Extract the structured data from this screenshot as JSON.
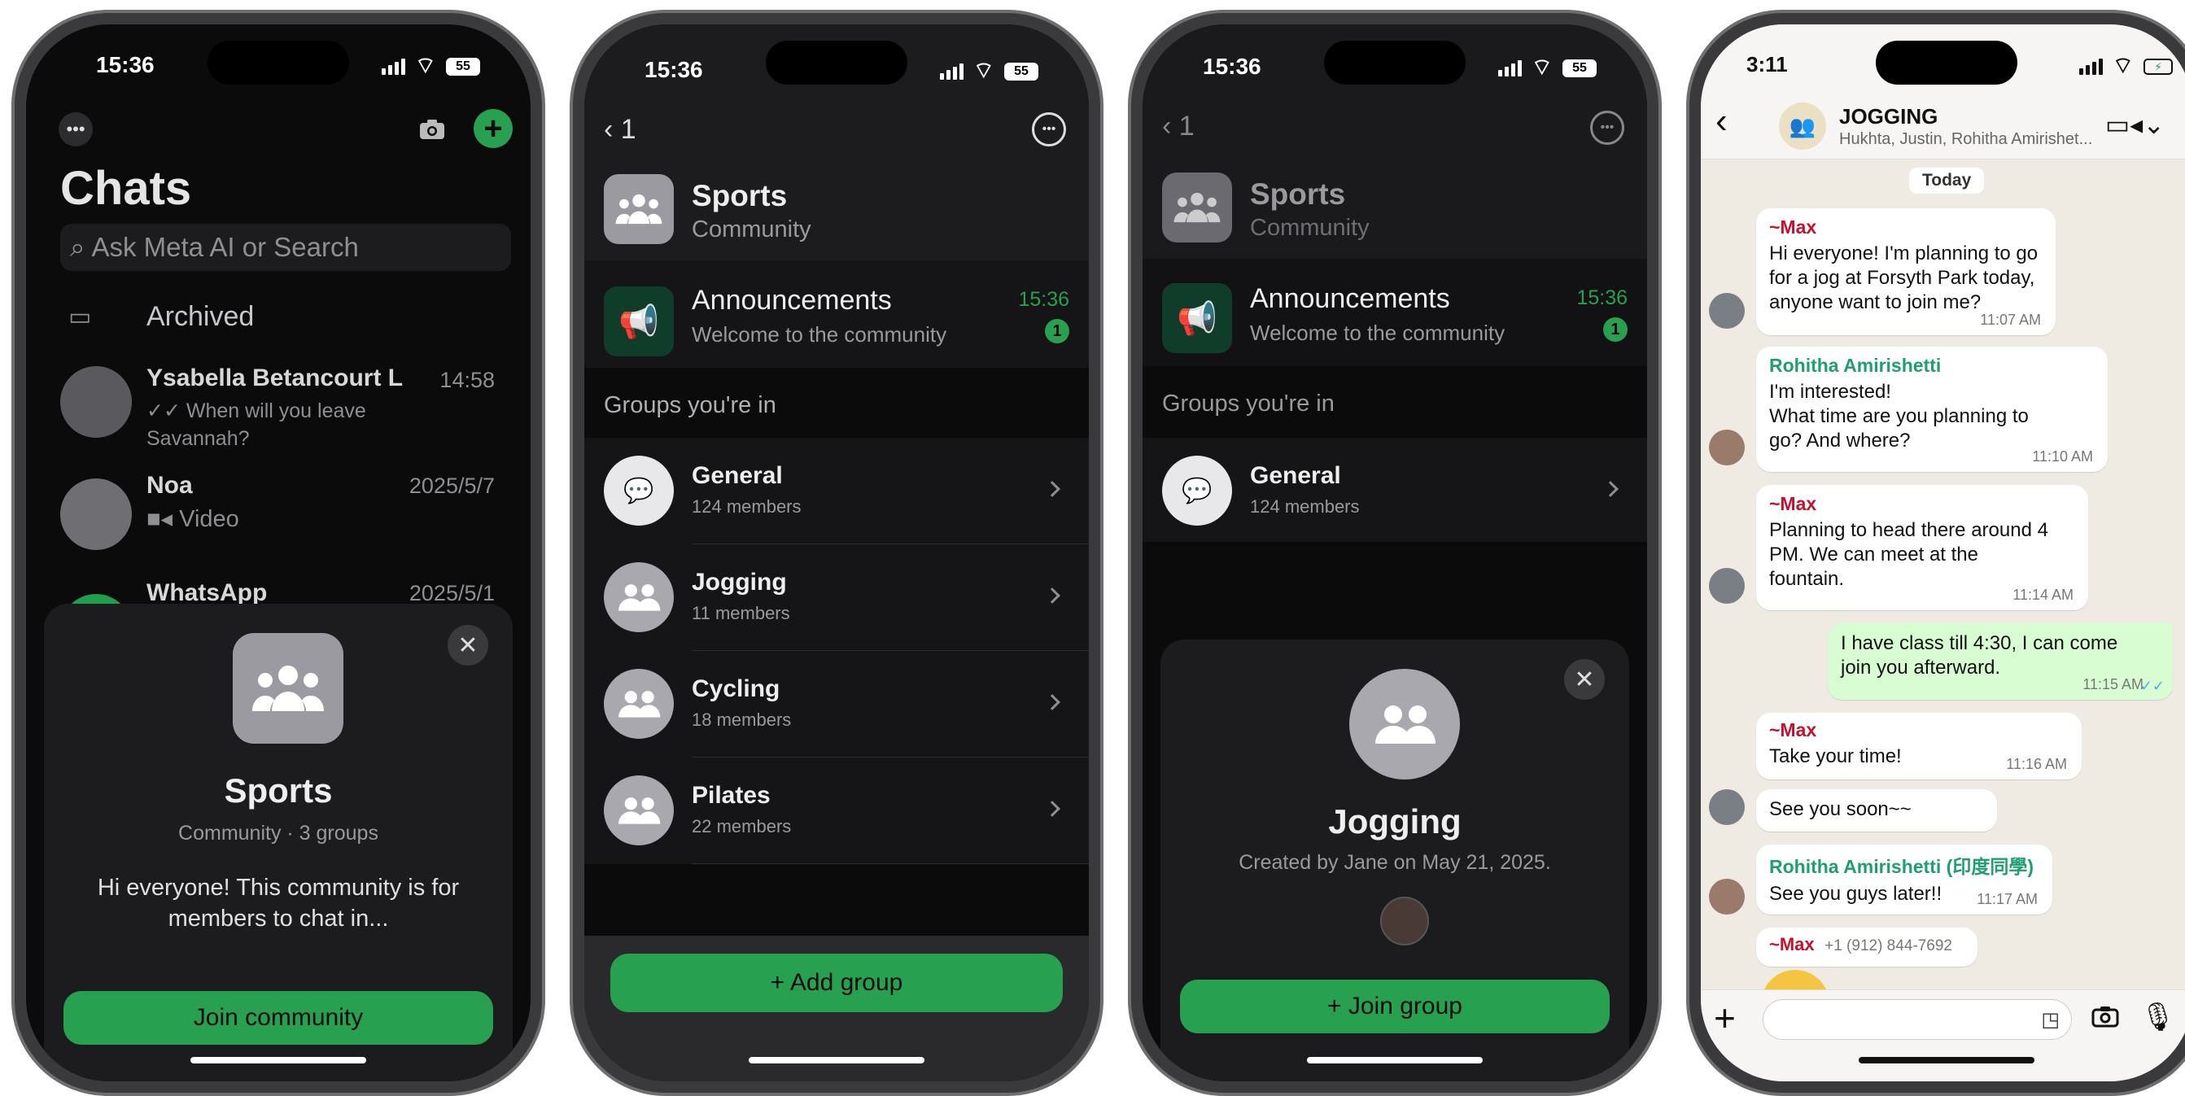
{
  "phone1": {
    "time": "15:36",
    "battery": "55",
    "title": "Chats",
    "search_placeholder": "Ask Meta AI or Search",
    "archived": "Archived",
    "chats": [
      {
        "name": "Ysabella Betancourt L",
        "time": "14:58",
        "preview": "When will you leave Savannah?"
      },
      {
        "name": "Noa",
        "time": "2025/5/7",
        "preview": "Video"
      },
      {
        "name": "WhatsApp",
        "time": "2025/5/1"
      }
    ],
    "sheet": {
      "title": "Sports",
      "subtitle": "Community · 3 groups",
      "description": "Hi everyone! This community is for members to chat in...",
      "join_label": "Join community"
    }
  },
  "phone2": {
    "time": "15:36",
    "battery": "55",
    "back_count": "1",
    "community_name": "Sports",
    "community_sub": "Community",
    "announcements": {
      "title": "Announcements",
      "subtitle": "Welcome to the community",
      "time": "15:36",
      "badge": "1"
    },
    "section": "Groups you're in",
    "groups": [
      {
        "name": "General",
        "members": "124 members"
      },
      {
        "name": "Jogging",
        "members": "11 members"
      },
      {
        "name": "Cycling",
        "members": "18 members"
      },
      {
        "name": "Pilates",
        "members": "22 members"
      }
    ],
    "add_group": "+ Add group"
  },
  "phone3": {
    "time": "15:36",
    "battery": "55",
    "back_count": "1",
    "community_name": "Sports",
    "community_sub": "Community",
    "announcements": {
      "title": "Announcements",
      "subtitle": "Welcome to the community",
      "time": "15:36",
      "badge": "1"
    },
    "section": "Groups you're in",
    "groups": [
      {
        "name": "General",
        "members": "124 members"
      }
    ],
    "sheet": {
      "title": "Jogging",
      "created": "Created by Jane on May 21, 2025.",
      "join_label": "+ Join group"
    }
  },
  "phone4": {
    "time": "3:11",
    "group_name": "JOGGING",
    "members_line": "Hukhta, Justin, Rohitha Amirishet...",
    "date_chip": "Today",
    "messages": [
      {
        "sender": "~Max",
        "text": "Hi everyone! I'm planning to go\nfor a jog at Forsyth Park today,\nanyone want to join me?",
        "time": "11:07 AM"
      },
      {
        "sender": "Rohitha Amirishetti",
        "text": "I'm interested!\nWhat time are you planning to\ngo? And where?",
        "time": "11:10 AM"
      },
      {
        "sender": "~Max",
        "text": "Planning to head there around 4\nPM. We can meet at the\nfountain.",
        "time": "11:14 AM"
      },
      {
        "sender": "",
        "text": "I have class till 4:30, I can come\njoin you afterward.",
        "time": "11:15 AM"
      },
      {
        "sender": "~Max",
        "text": "Take your time!",
        "time": "11:16 AM"
      },
      {
        "sender": "",
        "text": "See you soon~~",
        "time": ""
      },
      {
        "sender": "Rohitha Amirishetti (印度同學)",
        "text": "See you guys later!!",
        "time": "11:17 AM"
      },
      {
        "sender": "~Max",
        "phone": "+1 (912) 844-7692",
        "text": "",
        "time": ""
      }
    ]
  },
  "colors": {
    "accent": "#27a050",
    "sender_max": "#c8102e",
    "sender_rohitha": "#1f9e6e",
    "chat_bg": "#efeae2",
    "sent_bubble": "#d9fdd3"
  }
}
